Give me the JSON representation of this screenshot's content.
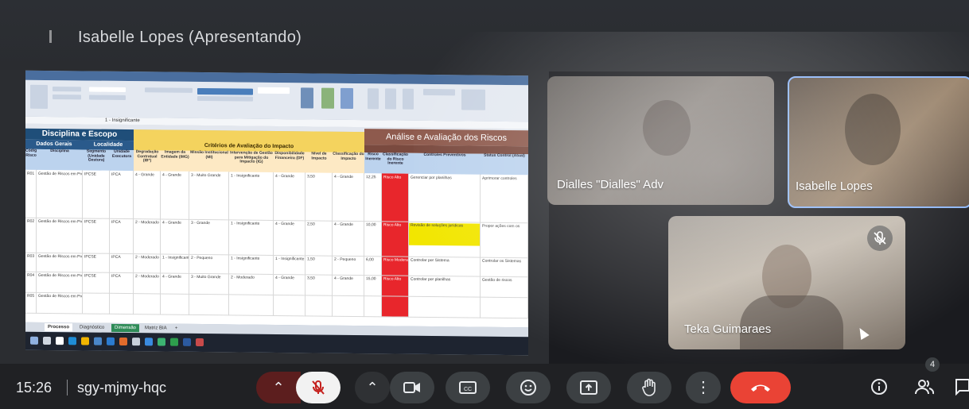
{
  "presenter_title": "Isabelle Lopes (Apresentando)",
  "spreadsheet": {
    "block_disciplina": "Disciplina e Escopo",
    "col_dados_gerais": "Dados Gerais",
    "col_localidade": "Localidade",
    "criterios": "Critérios de Avaliação do Impacto",
    "analise": "Análise e Avaliação dos Riscos",
    "formula_value": "1 - Insignificante",
    "sub_headers": [
      "Código Risco",
      "Disciplina",
      "Segmento (Unidade Gestora)",
      "Unidade Executora",
      "Degradação Contratual (IB*)",
      "Imagem da Entidade (IMG)",
      "Missão Institucional (MI)",
      "Intervenção de Gestão para Mitigação do Impacto (IG)",
      "Disponibilidade Financeira (DF)",
      "Nível de Impacto",
      "Classificação do Impacto",
      "Risco Inerente",
      "Classificação do Risco Inerente",
      "Controles Preventivos",
      "Status Control (Atual)"
    ],
    "rows": [
      [
        "R01",
        "Gestão de Riscos em Processos",
        "IPCSE",
        "IPCA",
        "4 - Grande",
        "4 - Grande",
        "3 - Muito Grande",
        "1 - Insignificante",
        "4 - Grande",
        "3,50",
        "4 - Grande",
        "12,25",
        "Risco Alto",
        "Gerenciar por planilhas",
        "Aprimorar controles"
      ],
      [
        "R02",
        "Gestão de Riscos em Processos",
        "IPCSE",
        "IPCA",
        "2 - Moderado",
        "4 - Grande",
        "3 - Grande",
        "1 - Insignificante",
        "4 - Grande",
        "2,50",
        "4 - Grande",
        "10,00",
        "Risco Alto",
        "Revisão de soluções jurídicas",
        "Propor ações com os"
      ],
      [
        "R03",
        "Gestão de Riscos em Processos",
        "IPCSE",
        "IPCA",
        "2 - Moderado",
        "1 - Insignificante",
        "2 - Pequeno",
        "1 - Insignificante",
        "1 - Insignificante",
        "1,50",
        "2 - Pequeno",
        "6,00",
        "Risco Moderado",
        "Controlar por Sistema",
        "Controlar os Sistemas"
      ],
      [
        "R04",
        "Gestão de Riscos em Processos",
        "IPCSE",
        "IPCA",
        "2 - Moderado",
        "4 - Grande",
        "3 - Muito Grande",
        "2 - Moderado",
        "4 - Grande",
        "3,50",
        "4 - Grande",
        "15,00",
        "Risco Alto",
        "Controlar por planilhas",
        "Gestão de riscos"
      ],
      [
        "R05",
        "Gestão de Riscos em Processos",
        "",
        "",
        "",
        "",
        "",
        "",
        "",
        "",
        "",
        "",
        "",
        "",
        ""
      ]
    ],
    "tabs": [
      "Processo",
      "Diagnóstico",
      "Dimensão",
      "Matriz BIA",
      "+"
    ]
  },
  "participants": [
    {
      "name": "Dialles \"Dialles\" Adv",
      "muted": false
    },
    {
      "name": "Isabelle Lopes",
      "muted": false
    },
    {
      "name": "Teka Guimaraes",
      "muted": true
    }
  ],
  "bottom_bar": {
    "time": "15:26",
    "meeting_code": "sgy-mjmy-hqc",
    "participant_count": "4",
    "controls": [
      "mic-options",
      "mic",
      "camera-options",
      "camera",
      "captions",
      "reactions",
      "present",
      "raise-hand",
      "more-options",
      "leave-call"
    ]
  },
  "colors": {
    "leave": "#ea4335",
    "control_bg": "#3c4043",
    "active_speaker_border": "#8ab4f8",
    "risk_high": "#e8262c"
  }
}
